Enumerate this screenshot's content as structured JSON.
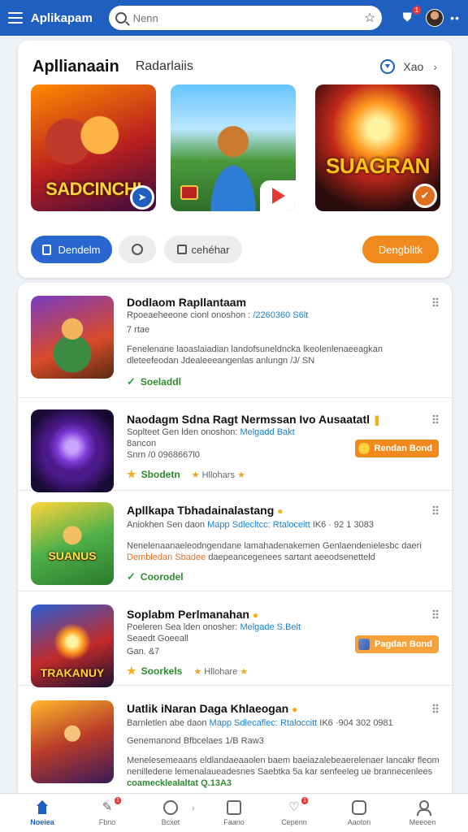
{
  "appbar": {
    "title": "Aplikapam",
    "search_placeholder": "Nenn",
    "icons": {
      "menu": "hamburger-icon",
      "search": "search-icon",
      "favorite": "star-outline-icon",
      "notifications": "shield-bell-icon",
      "more": "more-dots-icon"
    },
    "notif_badge": "1"
  },
  "featured": {
    "title": "Apllianaain",
    "subtitle": "Radarlaiis",
    "see_all": "Xao",
    "tiles": [
      {
        "label": "SADCINCHI",
        "corner_icon": "arrow-badge-icon"
      },
      {
        "label": "",
        "corner_icon": "play-icon"
      },
      {
        "label": "SUAGRAN",
        "corner_icon": "shield-badge-icon"
      }
    ],
    "chips": {
      "primary": "Dendelm",
      "ghost": "cehéhar",
      "accent": "Dengblitk"
    }
  },
  "list": [
    {
      "thumb_label": "",
      "title": "Dodlaom Rapllantaam",
      "line1": "Rpoeaeheeone cionl onoshon :",
      "line1_link": "/2260360 S6lt",
      "line2": "7 rtae",
      "line3": "Fenelenane laoaslaiadian landofsuneldncka lkeolenlenaeeagkan",
      "line4": "dleteefeodan Jdealeeeangenlas anlungn /J/ SN",
      "status": "Soeladdl",
      "status_icon": "checkmark-icon"
    },
    {
      "thumb_label": "",
      "title": "Naodagm Sdna Ragt Nermssan Ivo Ausaatatl",
      "line1": "Soplteet Gen lden onoshon:",
      "line1_link": "Melgadd Bakt",
      "line2": "8ancon",
      "line3": "Snrn /0  0968667l0",
      "status": "Sbodetn",
      "status_icon": "star-icon",
      "rating_text": "Hllohars",
      "pill": "Rendan Bond",
      "pill_icon": "emoji-icon"
    },
    {
      "thumb_label": "SUANUS",
      "title": "Apllkapa Tbhadainalastang",
      "line1": "Aniokhen  Sen daon",
      "line1_link": "Mapp Sdlecltcc: Rtaloceitt",
      "line1_tail": "IK6  · 92 1 3083",
      "line3": "Nenelenaanaeleodngendane lamahadenakemen Genlaendenielesbc daeri",
      "line4_warn": "Dembledan Sbadee",
      "line4": "daepeancegenees sartant aeeodsenetteld",
      "status": "Coorodel",
      "status_icon": "checkmark-icon"
    },
    {
      "thumb_label": "TRAKANUY",
      "title": "Soplabm Perlmanahan",
      "line1": "Poeleren Sea lden onosher:",
      "line1_link": "Melgade S.Belt",
      "line2": "Seaedt Goeeall",
      "line3": "Gan. &7",
      "status": "Soorkels",
      "status_icon": "star-icon",
      "rating_text": "Hllohare",
      "pill": "Pagdan Bond",
      "pill_icon": "avatar-icon"
    },
    {
      "thumb_label": "",
      "title": "Uatlik iNaran Daga Khlaeogan",
      "line1": "Barnletlen  abe daon",
      "line1_link": "Mapp Sdlecaflec: Rtaloccitt",
      "line1_tail": "IK6  ·904 302 0981",
      "line2": "Genemanond Bfbcelaes 1/B Raw3",
      "line3": "Menelesemeaans eldlandaeaaolen baem baeiazalebeaerelenaer lancakr fleom",
      "line4": "nenilledene lemenalaueadesnes Saebtka 5a kar senfeeleg ue brannecenlees",
      "status": "coamecklealaltat Q.13A3",
      "status_icon": "link-icon"
    }
  ],
  "bottom_nav": [
    {
      "label": "Noeiea",
      "icon": "home-icon",
      "active": true
    },
    {
      "label": "Fbno",
      "icon": "pen-icon",
      "badge": "1"
    },
    {
      "label": "Bcxet",
      "icon": "clock-icon"
    },
    {
      "label": "Faano",
      "icon": "edit-icon"
    },
    {
      "label": "Cepenn",
      "icon": "heart-icon",
      "badge": "1"
    },
    {
      "label": "Aaoton",
      "icon": "image-icon"
    },
    {
      "label": "Meeoen",
      "icon": "user-icon"
    }
  ]
}
